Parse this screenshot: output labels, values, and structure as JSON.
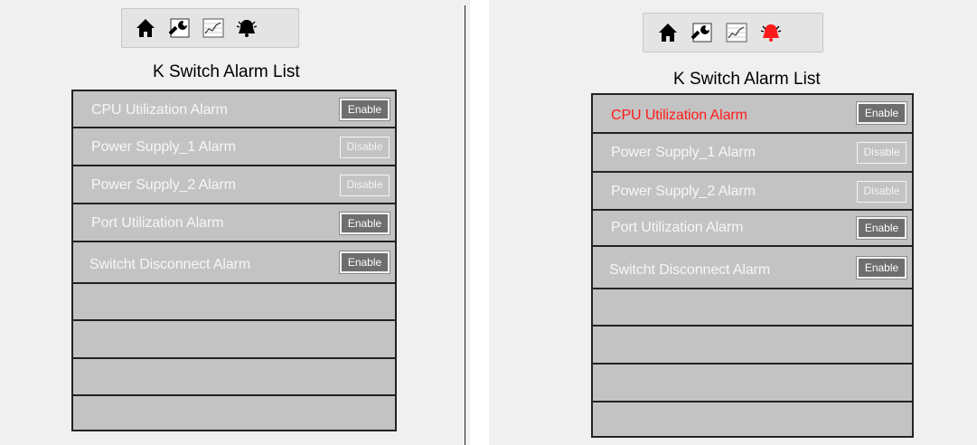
{
  "toolbar": {
    "buttons": [
      {
        "icon": "home-icon"
      },
      {
        "icon": "wrench-icon"
      },
      {
        "icon": "chart-icon"
      },
      {
        "icon": "alarm-bell-icon"
      }
    ],
    "bell_color_default": "#000000",
    "bell_color_alert": "#ff1a1a"
  },
  "left_panel": {
    "title": "K  Switch Alarm List",
    "rows": [
      {
        "label": "CPU Utilization Alarm",
        "button": "Enable"
      },
      {
        "label": "Power Supply_1 Alarm",
        "button": "Disable"
      },
      {
        "label": "Power Supply_2 Alarm",
        "button": "Disable"
      },
      {
        "label": "Port Utilization Alarm",
        "button": "Enable"
      },
      {
        "label": "Switcht Disconnect  Alarm",
        "button": "Enable"
      }
    ]
  },
  "right_panel": {
    "title": "K  Switch Alarm List",
    "rows": [
      {
        "label": "CPU Utilization Alarm",
        "button": "Enable",
        "alert": true
      },
      {
        "label": "Power Supply_1 Alarm",
        "button": "Disable"
      },
      {
        "label": "Power Supply_2 Alarm",
        "button": "Disable"
      },
      {
        "label": "Port Utilization Alarm",
        "button": "Enable"
      },
      {
        "label": "Switcht Disconnect  Alarm",
        "button": "Enable"
      }
    ]
  },
  "colors": {
    "row_bg": "#c3c3c3",
    "alert_text": "#ff1a1a",
    "enable_bg": "#6e6e6e"
  }
}
